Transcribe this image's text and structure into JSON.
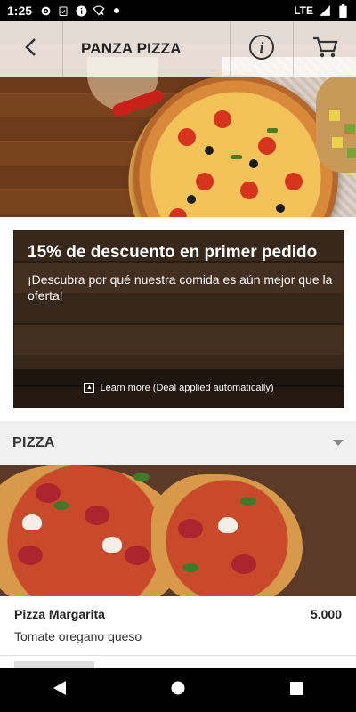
{
  "status_bar": {
    "time": "1:25",
    "network": "LTE"
  },
  "app_bar": {
    "title": "PANZA PIZZA",
    "icons": [
      "back-arrow-icon",
      "info-icon",
      "cart-icon"
    ]
  },
  "promo": {
    "title": "15% de descuento en primer pedido",
    "subtitle": "¡Descubra por qué nuestra comida es aún mejor que la oferta!",
    "footer": "Learn more (Deal applied automatically)"
  },
  "category": {
    "label": "PIZZA"
  },
  "products": [
    {
      "name": "Pizza Margarita",
      "price": "5.000",
      "description": "Tomate oregano queso"
    }
  ],
  "colors": {
    "appbar_bg": "#ffffff",
    "section_bg": "#f0f0f0",
    "navbar_bg": "#000000"
  }
}
